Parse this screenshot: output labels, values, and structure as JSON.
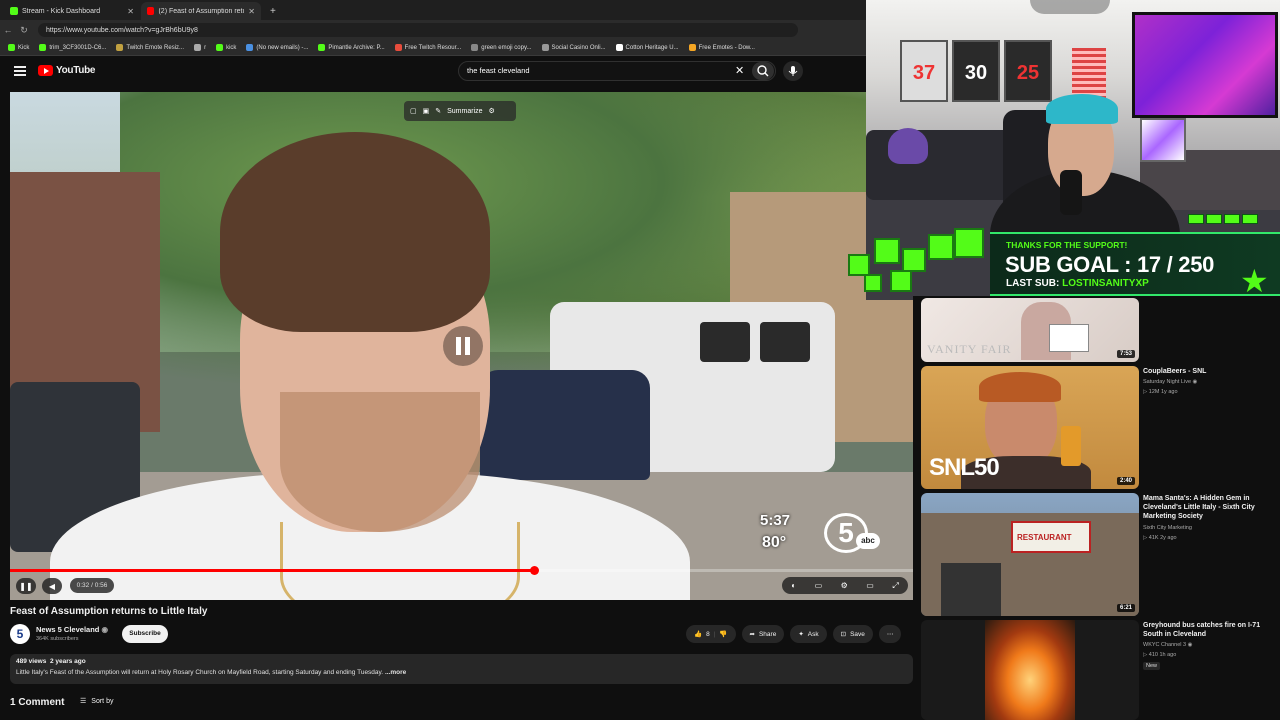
{
  "browser": {
    "tabs": [
      {
        "label": "Stream - Kick Dashboard",
        "icon": "kick-icon"
      },
      {
        "label": "(2) Feast of Assumption return",
        "icon": "youtube-icon"
      }
    ],
    "url": "https://www.youtube.com/watch?v=gJrBh6bU9y8",
    "bookmarks": [
      "Kick",
      "trim_3CF3001D-C6...",
      "Twitch Emote Resiz...",
      "r",
      "kick",
      "(No new emails) -...",
      "Pimantle Archive: P...",
      "Free Twitch Resour...",
      "green emoji copy...",
      "Social Casino Onli...",
      "Cotton Heritage U...",
      "Free Emotes - Dow..."
    ]
  },
  "youtube": {
    "logo_text": "YouTube",
    "search_query": "the feast cleveland",
    "summarize_label": "Summarize"
  },
  "video": {
    "time_display": "0:32 / 0:56",
    "progress_fraction": 0.58,
    "weather_time": "5:37",
    "weather_temp": "80°",
    "station_number": "5",
    "station_network": "abc",
    "title": "Feast of Assumption returns to Little Italy",
    "channel": "News 5 Cleveland",
    "subscribers": "364K subscribers",
    "subscribe_label": "Subscribe",
    "likes": "8",
    "share_label": "Share",
    "ask_label": "Ask",
    "save_label": "Save",
    "views_date": "489 views  2 years ago",
    "description": "Little Italy's Feast of the Assumption will return at Holy Rosary Church on Mayfield Road, starting Saturday and ending Tuesday.",
    "more_label": "...more",
    "comments_count": "1 Comment",
    "sort_label": "Sort by"
  },
  "overlay": {
    "thanks": "THANKS FOR THE SUPPORT!",
    "goal": "SUB GOAL : 17 / 250",
    "last_sub_label": "LAST SUB:",
    "last_sub_name": "LOSTINSANITYXP",
    "accent": "#53fc18"
  },
  "recommendations": [
    {
      "thumb_text": "VANITY FAIR",
      "duration": "7:53",
      "title": "",
      "channel": "",
      "meta": ""
    },
    {
      "thumb_text": "SNL50",
      "duration": "2:40",
      "title": "CouplaBeers - SNL",
      "channel": "Saturday Night Live",
      "meta": "12M  1y ago"
    },
    {
      "thumb_text": "RESTAURANT",
      "duration": "6:21",
      "title": "Mama Santa's: A Hidden Gem in Cleveland's Little Italy - Sixth City Marketing Society",
      "channel": "Sixth City Marketing",
      "meta": "41K  2y ago"
    },
    {
      "thumb_text": "",
      "duration": "",
      "title": "Greyhound bus catches fire on I-71 South in Cleveland",
      "channel": "WKYC Channel 3",
      "meta": "410  1h ago",
      "badge": "New"
    }
  ]
}
